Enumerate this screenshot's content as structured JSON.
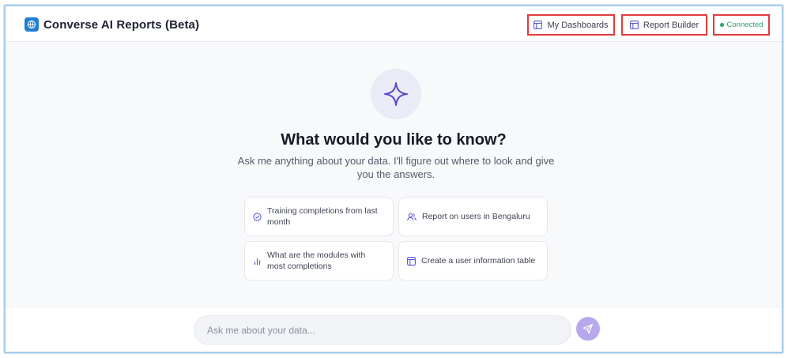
{
  "app": {
    "title": "Converse AI Reports (Beta)",
    "logo_icon": "globe-logo-icon",
    "brand_color": "#1f7fd1"
  },
  "header": {
    "dashboards_label": "My Dashboards",
    "dashboards_icon": "layout-icon",
    "report_builder_label": "Report Builder",
    "report_builder_icon": "layout-icon",
    "status_label": "Connected",
    "status_color": "#27a56a"
  },
  "hero": {
    "icon": "sparkle-icon",
    "title": "What would you like to know?",
    "subtitle": "Ask me anything about your data. I'll figure out where to look and give you the answers."
  },
  "suggestions": [
    {
      "label": "Training completions from last month",
      "icon": "check-circle-icon"
    },
    {
      "label": "Report on users in Bengaluru",
      "icon": "users-icon"
    },
    {
      "label": "What are the modules with most completions",
      "icon": "bar-chart-icon"
    },
    {
      "label": "Create a user information table",
      "icon": "table-icon"
    }
  ],
  "chat": {
    "placeholder": "Ask me about your data...",
    "send_icon": "send-icon",
    "accent": "#b8a8ee"
  }
}
